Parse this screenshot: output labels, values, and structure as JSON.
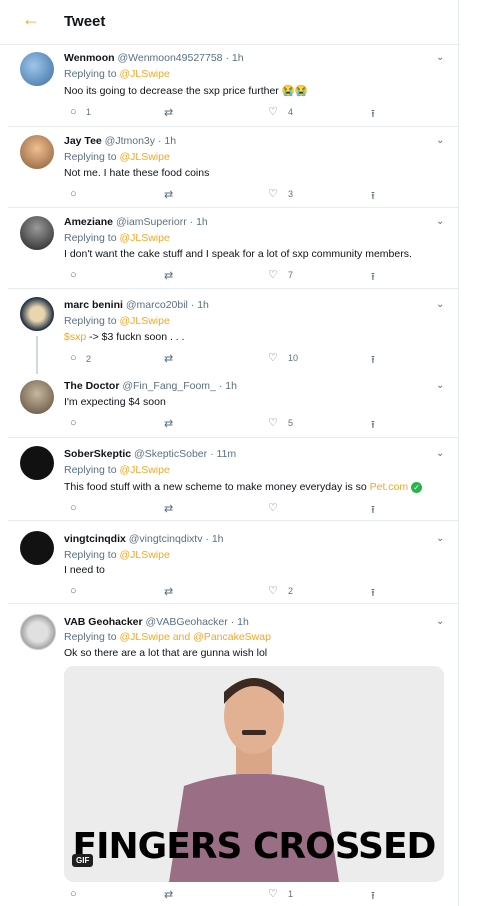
{
  "header": {
    "back_icon": "arrow-left-icon",
    "title": "Tweet"
  },
  "tweets": [
    {
      "name": "Wenmoon",
      "handle": "@Wenmoon49527758",
      "time": "1h",
      "replying_prefix": "Replying to ",
      "replying_to": "@JLSwipe",
      "text": "Noo its going to decrease the sxp price further",
      "reply_count": "1",
      "like_count": "4"
    },
    {
      "name": "Jay Tee",
      "handle": "@Jtmon3y",
      "time": "1h",
      "replying_prefix": "Replying to ",
      "replying_to": "@JLSwipe",
      "text": "Not me. I hate these food coins",
      "like_count": "3"
    },
    {
      "name": "Ameziane",
      "handle": "@iamSuperiorr",
      "time": "1h",
      "replying_prefix": "Replying to ",
      "replying_to": "@JLSwipe",
      "text": "I don't want the cake stuff and I speak for a lot of sxp community members.",
      "like_count": "7"
    },
    {
      "name": "marc benini",
      "handle": "@marco20bil",
      "time": "1h",
      "replying_prefix": "Replying to ",
      "replying_to": "@JLSwipe",
      "cashtag": "$sxp",
      "text": " -> $3 fuckn soon . . .",
      "reply_count": "2",
      "like_count": "10"
    },
    {
      "name": "The Doctor",
      "handle": "@Fin_Fang_Foom_",
      "time": "1h",
      "text": "I'm expecting $4 soon",
      "like_count": "5"
    },
    {
      "name": "SoberSkeptic",
      "handle": "@SkepticSober",
      "time": "11m",
      "replying_prefix": "Replying to ",
      "replying_to": "@JLSwipe",
      "text": "This food stuff with a new scheme to make money everyday is so ",
      "link": "Pet.com"
    },
    {
      "name": "vingtcinqdix",
      "handle": "@vingtcinqdixtv",
      "time": "1h",
      "replying_prefix": "Replying to ",
      "replying_to": "@JLSwipe",
      "text": "I need to",
      "like_count": "2"
    },
    {
      "name": "VAB Geohacker",
      "handle": "@VABGeohacker",
      "time": "1h",
      "replying_prefix": "Replying to ",
      "replying_to": "@JLSwipe and @PancakeSwap",
      "text": "Ok so there are a lot that are gunna wish lol",
      "gif_caption": "FINGERS CROSSED",
      "gif_badge": "GIF",
      "like_count": "1"
    }
  ],
  "icons": {
    "reply": "reply-icon",
    "retweet": "retweet-icon",
    "like": "heart-icon",
    "share": "share-icon",
    "more": "chevron-down-icon"
  },
  "colors": {
    "accent": "#f5a623",
    "meta": "#5b7083",
    "border": "#e6ecf0"
  }
}
